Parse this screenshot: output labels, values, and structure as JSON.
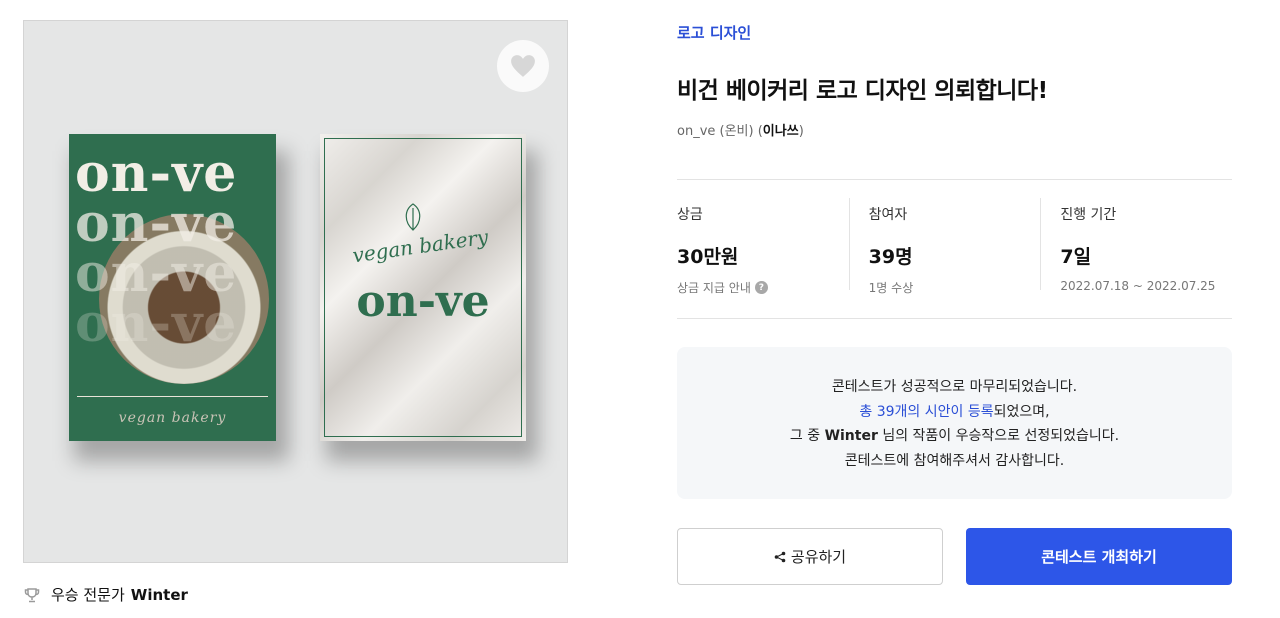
{
  "hero": {
    "card_left_wordmark": "on-ve",
    "card_left_script": "vegan bakery",
    "card_right_script": "vegan bakery",
    "card_right_wordmark": "on-ve",
    "brand_green": "#2f6e4f",
    "heart_icon": "heart-icon"
  },
  "winner": {
    "label": "우승 전문가",
    "name": "Winter",
    "icon": "trophy-icon"
  },
  "contest": {
    "category": "로고 디자인",
    "title": "비건 베이커리 로고 디자인 의뢰합니다!",
    "author_prefix": "on_ve (온비) (",
    "author_company": "이나쓰",
    "author_suffix": ")"
  },
  "stats": [
    {
      "label": "상금",
      "value": "30만원",
      "sub": "상금 지급 안내"
    },
    {
      "label": "참여자",
      "value": "39명",
      "sub": "1명 수상"
    },
    {
      "label": "진행 기간",
      "value": "7일",
      "sub": "2022.07.18 ~ 2022.07.25"
    }
  ],
  "notice": {
    "line1": "콘테스트가 성공적으로 마무리되었습니다.",
    "line2_link": "총 39개의 시안이 등록",
    "line2_rest": "되었으며,",
    "line3_pre": "그 중 ",
    "line3_name": "Winter",
    "line3_post": " 님의 작품이 우승작으로 선정되었습니다.",
    "line4": "콘테스트에 참여해주셔서 감사합니다."
  },
  "actions": {
    "share_label": "공유하기",
    "host_label": "콘테스트 개최하기",
    "accent": "#2d56e8"
  }
}
